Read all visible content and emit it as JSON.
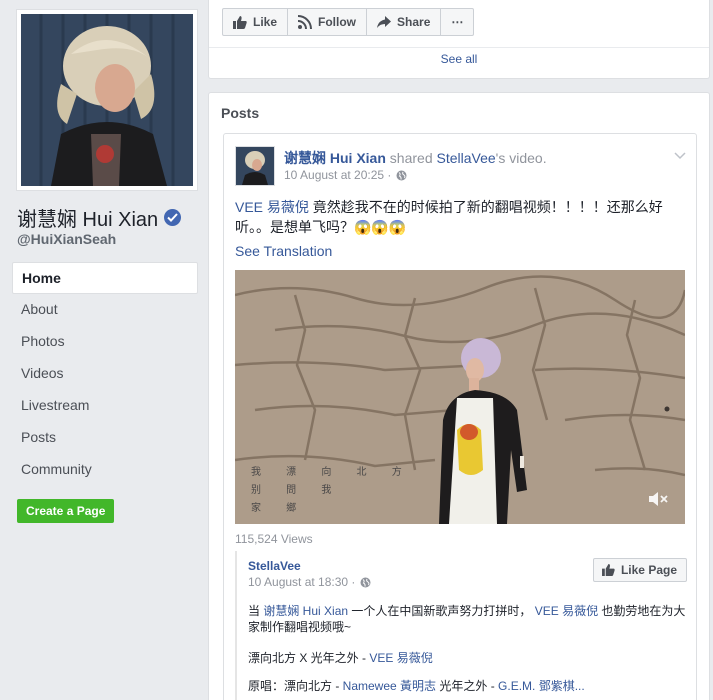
{
  "sidebar": {
    "name": "谢慧娴 Hui Xian",
    "handle": "@HuiXianSeah",
    "nav": [
      "Home",
      "About",
      "Photos",
      "Videos",
      "Livestream",
      "Posts",
      "Community"
    ],
    "create_page": "Create a Page"
  },
  "top_actions": {
    "like": "Like",
    "follow": "Follow",
    "share": "Share",
    "more": "⋯",
    "see_all": "See all"
  },
  "posts": {
    "header": "Posts",
    "post": {
      "author": "谢慧娴 Hui Xian",
      "shared_word": " shared ",
      "shared_source": "StellaVee",
      "shared_tail": "'s video.",
      "timestamp": "10 August at 20:25 ·",
      "text_mention": "VEE 易薇倪",
      "text_body": " 竟然趁我不在的时候拍了新的翻唱视频！！！！还那么好听。。是想单飞吗？😱😱😱",
      "see_translation": "See Translation",
      "video_lyrics": [
        "我 漂 向 北 方",
        "别 問 我",
        "家 鄉"
      ],
      "views": "115,524 Views",
      "shared": {
        "author": "StellaVee",
        "timestamp": "10 August at 18:30 ·",
        "like_page": "Like Page",
        "t1": "当 ",
        "t1_mention": "谢慧娴 Hui Xian",
        "t2": " 一个人在中国新歌声努力打拼时， ",
        "t2_mention": "VEE 易薇倪",
        "t3": " 也勤劳地在为大家制作翻唱视频哦~",
        "line2": "漂向北方 X 光年之外 - ",
        "line2_mention": "VEE 易薇倪",
        "line3": "原唱：漂向北方 - ",
        "line3_mention1": "Namewee 黃明志",
        "line3_mid": " 光年之外 - ",
        "line3_mention2": "G.E.M. 鄧紫棋..."
      }
    }
  }
}
